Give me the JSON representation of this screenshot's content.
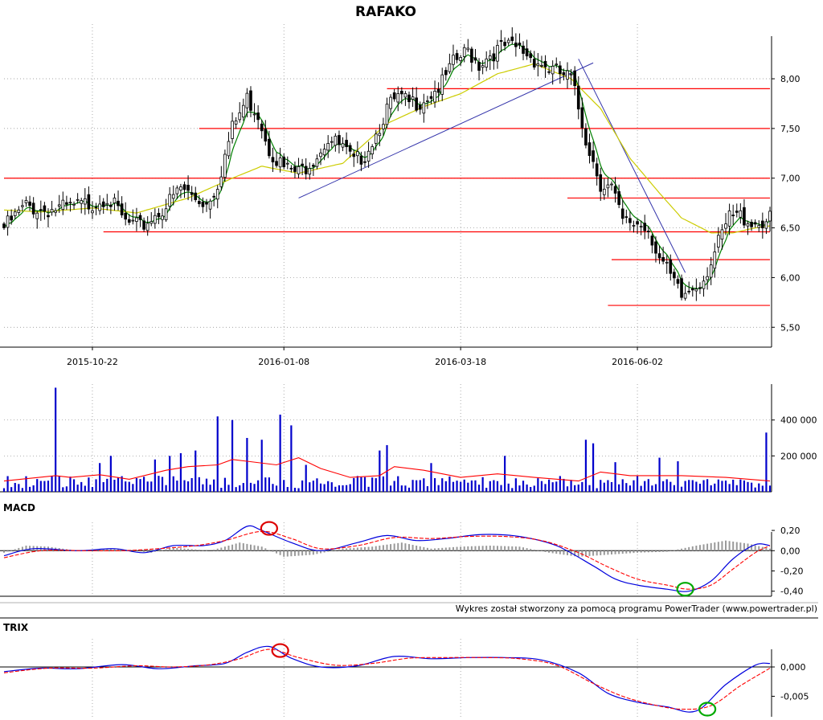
{
  "chart_data": {
    "type": "candlestick",
    "title": "RAFAKO",
    "colors": {
      "up": "#ffffff",
      "down": "#000000",
      "ema_fast": "#008000",
      "ema_slow": "#cccc00",
      "hline": "#ff0000",
      "trendline": "#3333aa",
      "volume": "#0000cc",
      "volume_avg": "#ff0000",
      "macd": "#0000dd",
      "signal": "#ff0000",
      "histogram": "#999999",
      "trix": "#0000dd",
      "trix_signal": "#ff0000",
      "circle_sell": "#dd0000",
      "circle_buy": "#00aa00"
    },
    "x_ticks": [
      "2015-10-22",
      "2016-01-08",
      "2016-03-18",
      "2016-06-02"
    ],
    "x_tick_index": [
      24,
      76,
      124,
      172
    ],
    "price": {
      "ylim": [
        5.3,
        8.55
      ],
      "yticks": [
        "5,50",
        "6,00",
        "6,50",
        "7,00",
        "7,50",
        "8,00"
      ],
      "ytick_values": [
        5.5,
        6.0,
        6.5,
        7.0,
        7.5,
        8.0
      ],
      "close_path": [
        [
          0,
          6.5
        ],
        [
          6,
          6.72
        ],
        [
          10,
          6.68
        ],
        [
          18,
          6.7
        ],
        [
          24,
          6.75
        ],
        [
          28,
          6.82
        ],
        [
          33,
          6.55
        ],
        [
          37,
          6.5
        ],
        [
          40,
          6.6
        ],
        [
          44,
          6.72
        ],
        [
          48,
          6.9
        ],
        [
          52,
          6.8
        ],
        [
          55,
          6.75
        ],
        [
          58,
          6.95
        ],
        [
          62,
          7.5
        ],
        [
          66,
          7.8
        ],
        [
          69,
          7.65
        ],
        [
          72,
          7.3
        ],
        [
          76,
          7.1
        ],
        [
          80,
          7.05
        ],
        [
          84,
          7.2
        ],
        [
          88,
          7.4
        ],
        [
          92,
          7.3
        ],
        [
          95,
          7.15
        ],
        [
          98,
          7.25
        ],
        [
          101,
          7.45
        ],
        [
          104,
          7.7
        ],
        [
          107,
          7.8
        ],
        [
          110,
          7.75
        ],
        [
          113,
          7.78
        ],
        [
          116,
          7.85
        ],
        [
          119,
          7.95
        ],
        [
          122,
          8.15
        ],
        [
          126,
          8.28
        ],
        [
          129,
          8.15
        ],
        [
          132,
          8.25
        ],
        [
          136,
          8.32
        ],
        [
          140,
          8.3
        ],
        [
          144,
          8.2
        ],
        [
          148,
          8.1
        ],
        [
          151,
          8.05
        ],
        [
          154,
          8.0
        ],
        [
          158,
          7.4
        ],
        [
          162,
          6.95
        ],
        [
          165,
          6.9
        ],
        [
          168,
          6.55
        ],
        [
          172,
          6.55
        ],
        [
          175,
          6.5
        ],
        [
          178,
          6.2
        ],
        [
          181,
          6.0
        ],
        [
          184,
          5.8
        ],
        [
          187,
          5.9
        ],
        [
          190,
          6.0
        ],
        [
          193,
          6.25
        ],
        [
          197,
          6.6
        ],
        [
          200,
          6.62
        ],
        [
          204,
          6.55
        ],
        [
          208,
          6.58
        ]
      ],
      "ema_slow_path": [
        [
          0,
          6.68
        ],
        [
          10,
          6.66
        ],
        [
          24,
          6.7
        ],
        [
          36,
          6.65
        ],
        [
          50,
          6.8
        ],
        [
          62,
          7.0
        ],
        [
          70,
          7.12
        ],
        [
          80,
          7.05
        ],
        [
          92,
          7.15
        ],
        [
          104,
          7.55
        ],
        [
          114,
          7.72
        ],
        [
          124,
          7.85
        ],
        [
          134,
          8.05
        ],
        [
          144,
          8.15
        ],
        [
          154,
          8.0
        ],
        [
          162,
          7.7
        ],
        [
          170,
          7.2
        ],
        [
          178,
          6.85
        ],
        [
          184,
          6.6
        ],
        [
          192,
          6.45
        ],
        [
          198,
          6.45
        ],
        [
          204,
          6.5
        ],
        [
          208,
          6.52
        ]
      ],
      "hlines": [
        {
          "value": 7.9,
          "from": 104,
          "to": 208
        },
        {
          "value": 7.5,
          "from": 53,
          "to": 208
        },
        {
          "value": 7.0,
          "from": 0,
          "to": 208
        },
        {
          "value": 6.8,
          "from": 153,
          "to": 208
        },
        {
          "value": 6.46,
          "from": 27,
          "to": 208
        },
        {
          "value": 6.18,
          "from": 165,
          "to": 208
        },
        {
          "value": 5.72,
          "from": 164,
          "to": 208
        }
      ],
      "trendlines": [
        [
          [
            80,
            6.8
          ],
          [
            160,
            8.16
          ]
        ],
        [
          [
            156,
            8.2
          ],
          [
            185,
            6.05
          ]
        ]
      ]
    },
    "volume": {
      "ylim": [
        0,
        600000
      ],
      "yticks": [
        "200 000",
        "400 000"
      ],
      "ytick_values": [
        200000,
        400000
      ],
      "spikes": [
        [
          14,
          580000
        ],
        [
          26,
          160000
        ],
        [
          29,
          200000
        ],
        [
          41,
          180000
        ],
        [
          45,
          200000
        ],
        [
          48,
          215000
        ],
        [
          52,
          230000
        ],
        [
          58,
          420000
        ],
        [
          62,
          400000
        ],
        [
          66,
          300000
        ],
        [
          70,
          290000
        ],
        [
          75,
          430000
        ],
        [
          78,
          370000
        ],
        [
          82,
          150000
        ],
        [
          102,
          230000
        ],
        [
          104,
          260000
        ],
        [
          116,
          160000
        ],
        [
          136,
          200000
        ],
        [
          158,
          290000
        ],
        [
          160,
          270000
        ],
        [
          166,
          165000
        ],
        [
          178,
          190000
        ],
        [
          183,
          170000
        ],
        [
          207,
          330000
        ]
      ],
      "avg_path": [
        [
          0,
          60000
        ],
        [
          14,
          90000
        ],
        [
          18,
          80000
        ],
        [
          26,
          95000
        ],
        [
          34,
          70000
        ],
        [
          44,
          120000
        ],
        [
          50,
          140000
        ],
        [
          58,
          150000
        ],
        [
          62,
          180000
        ],
        [
          66,
          170000
        ],
        [
          74,
          150000
        ],
        [
          80,
          190000
        ],
        [
          86,
          130000
        ],
        [
          94,
          80000
        ],
        [
          102,
          90000
        ],
        [
          106,
          140000
        ],
        [
          114,
          120000
        ],
        [
          124,
          80000
        ],
        [
          134,
          100000
        ],
        [
          144,
          80000
        ],
        [
          156,
          60000
        ],
        [
          162,
          110000
        ],
        [
          170,
          90000
        ],
        [
          184,
          90000
        ],
        [
          196,
          80000
        ],
        [
          208,
          60000
        ]
      ]
    },
    "macd": {
      "title": "MACD",
      "ylim": [
        -0.45,
        0.28
      ],
      "yticks": [
        "0,20",
        "0,00",
        "-0,20",
        "-0,40"
      ],
      "ytick_values": [
        0.2,
        0.0,
        -0.2,
        -0.4
      ],
      "macd_path": [
        [
          0,
          -0.05
        ],
        [
          8,
          0.02
        ],
        [
          20,
          0.0
        ],
        [
          30,
          0.02
        ],
        [
          38,
          -0.02
        ],
        [
          46,
          0.05
        ],
        [
          54,
          0.05
        ],
        [
          60,
          0.1
        ],
        [
          66,
          0.24
        ],
        [
          70,
          0.2
        ],
        [
          78,
          0.08
        ],
        [
          86,
          0.0
        ],
        [
          96,
          0.08
        ],
        [
          104,
          0.15
        ],
        [
          112,
          0.1
        ],
        [
          120,
          0.12
        ],
        [
          130,
          0.16
        ],
        [
          140,
          0.14
        ],
        [
          150,
          0.05
        ],
        [
          160,
          -0.15
        ],
        [
          166,
          -0.28
        ],
        [
          172,
          -0.34
        ],
        [
          180,
          -0.38
        ],
        [
          186,
          -0.4
        ],
        [
          192,
          -0.3
        ],
        [
          198,
          -0.08
        ],
        [
          204,
          0.06
        ],
        [
          208,
          0.05
        ]
      ],
      "signal_path": [
        [
          0,
          -0.07
        ],
        [
          10,
          0.0
        ],
        [
          22,
          0.0
        ],
        [
          32,
          0.0
        ],
        [
          42,
          0.02
        ],
        [
          52,
          0.05
        ],
        [
          60,
          0.1
        ],
        [
          70,
          0.19
        ],
        [
          78,
          0.12
        ],
        [
          86,
          0.02
        ],
        [
          96,
          0.05
        ],
        [
          106,
          0.13
        ],
        [
          116,
          0.12
        ],
        [
          126,
          0.14
        ],
        [
          136,
          0.14
        ],
        [
          146,
          0.1
        ],
        [
          156,
          -0.02
        ],
        [
          164,
          -0.16
        ],
        [
          172,
          -0.28
        ],
        [
          180,
          -0.34
        ],
        [
          186,
          -0.38
        ],
        [
          192,
          -0.34
        ],
        [
          198,
          -0.18
        ],
        [
          204,
          -0.02
        ],
        [
          208,
          0.05
        ]
      ],
      "hist_path": [
        [
          0,
          -0.02
        ],
        [
          6,
          0.05
        ],
        [
          12,
          0.04
        ],
        [
          20,
          0.0
        ],
        [
          30,
          0.02
        ],
        [
          40,
          -0.02
        ],
        [
          46,
          0.03
        ],
        [
          56,
          0.0
        ],
        [
          64,
          0.08
        ],
        [
          70,
          0.04
        ],
        [
          76,
          -0.06
        ],
        [
          84,
          -0.04
        ],
        [
          92,
          0.02
        ],
        [
          100,
          0.04
        ],
        [
          108,
          0.08
        ],
        [
          116,
          0.02
        ],
        [
          124,
          0.04
        ],
        [
          132,
          0.05
        ],
        [
          140,
          0.04
        ],
        [
          148,
          -0.02
        ],
        [
          156,
          -0.06
        ],
        [
          164,
          -0.04
        ],
        [
          172,
          -0.02
        ],
        [
          180,
          -0.01
        ],
        [
          188,
          0.05
        ],
        [
          196,
          0.1
        ],
        [
          202,
          0.07
        ],
        [
          208,
          0.02
        ]
      ],
      "signals": [
        {
          "type": "sell",
          "index": 72,
          "value": 0.22
        },
        {
          "type": "buy",
          "index": 185,
          "value": -0.38
        }
      ]
    },
    "trix": {
      "title": "TRIX",
      "ylim": [
        -0.0085,
        0.0048
      ],
      "yticks": [
        "0,000",
        "-0,005"
      ],
      "ytick_values": [
        0.0,
        -0.005
      ],
      "trix_path": [
        [
          0,
          -0.0008
        ],
        [
          10,
          -0.0002
        ],
        [
          20,
          -0.0003
        ],
        [
          32,
          0.0004
        ],
        [
          42,
          -0.0003
        ],
        [
          52,
          0.0002
        ],
        [
          60,
          0.0006
        ],
        [
          66,
          0.0025
        ],
        [
          72,
          0.0035
        ],
        [
          78,
          0.0015
        ],
        [
          86,
          0.0
        ],
        [
          96,
          0.0002
        ],
        [
          106,
          0.0018
        ],
        [
          116,
          0.0014
        ],
        [
          126,
          0.0016
        ],
        [
          136,
          0.0016
        ],
        [
          146,
          0.0012
        ],
        [
          156,
          -0.001
        ],
        [
          164,
          -0.0045
        ],
        [
          172,
          -0.006
        ],
        [
          180,
          -0.0068
        ],
        [
          188,
          -0.0075
        ],
        [
          196,
          -0.003
        ],
        [
          204,
          0.0003
        ],
        [
          208,
          0.0006
        ]
      ],
      "signal_path": [
        [
          0,
          -0.001
        ],
        [
          12,
          -0.0002
        ],
        [
          24,
          -0.0002
        ],
        [
          36,
          0.0002
        ],
        [
          46,
          0.0
        ],
        [
          56,
          0.0004
        ],
        [
          64,
          0.0014
        ],
        [
          72,
          0.003
        ],
        [
          80,
          0.0016
        ],
        [
          90,
          0.0003
        ],
        [
          100,
          0.0006
        ],
        [
          110,
          0.0015
        ],
        [
          120,
          0.0016
        ],
        [
          130,
          0.0016
        ],
        [
          140,
          0.0014
        ],
        [
          150,
          0.0003
        ],
        [
          160,
          -0.0028
        ],
        [
          168,
          -0.005
        ],
        [
          176,
          -0.0064
        ],
        [
          184,
          -0.0072
        ],
        [
          192,
          -0.0066
        ],
        [
          200,
          -0.0032
        ],
        [
          208,
          -0.0002
        ]
      ],
      "signals": [
        {
          "type": "sell",
          "index": 75,
          "value": 0.0028
        },
        {
          "type": "buy",
          "index": 191,
          "value": -0.0072
        }
      ]
    }
  },
  "footer": {
    "credit": "Wykres został stworzony za pomocą programu PowerTrader (www.powertrader.pl)"
  }
}
